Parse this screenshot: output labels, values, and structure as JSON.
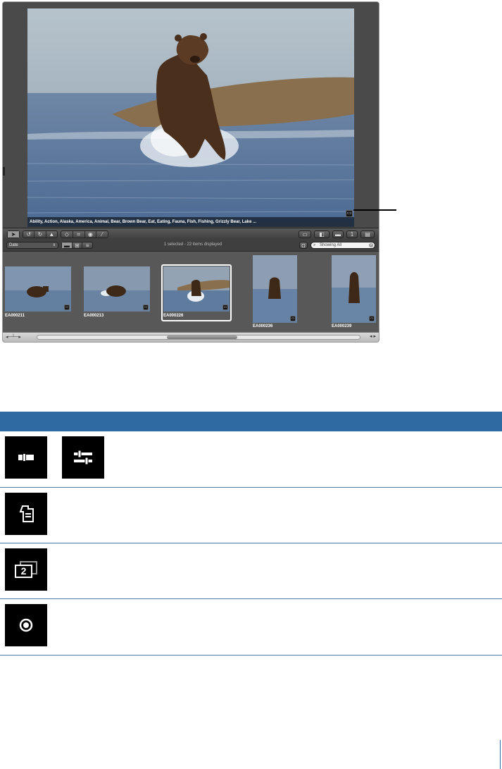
{
  "viewer": {
    "keywords": "Ability, Action, Alaska, America, Animal, Bear, Brown Bear, Eat, Eating, Fauna, Fish, Fishing, Grizzly Bear, Lake ..."
  },
  "filter_bar": {
    "sort_value": "Date",
    "status": "1 selected - 22 items displayed",
    "search_value": "Showing All"
  },
  "thumbnails": [
    {
      "name": "EA000211",
      "selected": false
    },
    {
      "name": "EA000213",
      "selected": false
    },
    {
      "name": "EA000226",
      "selected": true
    },
    {
      "name": "EA000236",
      "selected": false
    },
    {
      "name": "EA000239",
      "selected": false
    }
  ],
  "table": {
    "rows": [
      {
        "icons": [
          "metadata-overlay-collapsed-icon",
          "metadata-overlay-expanded-icon"
        ]
      },
      {
        "icons": [
          "auto-stack-badge-icon"
        ]
      },
      {
        "icons": [
          "stack-count-icon"
        ]
      },
      {
        "icons": [
          "target-circle-icon"
        ]
      }
    ],
    "stack_count": "2"
  },
  "colors": {
    "table_header": "#2f6aa3",
    "app_background": "#3a3a3a"
  }
}
